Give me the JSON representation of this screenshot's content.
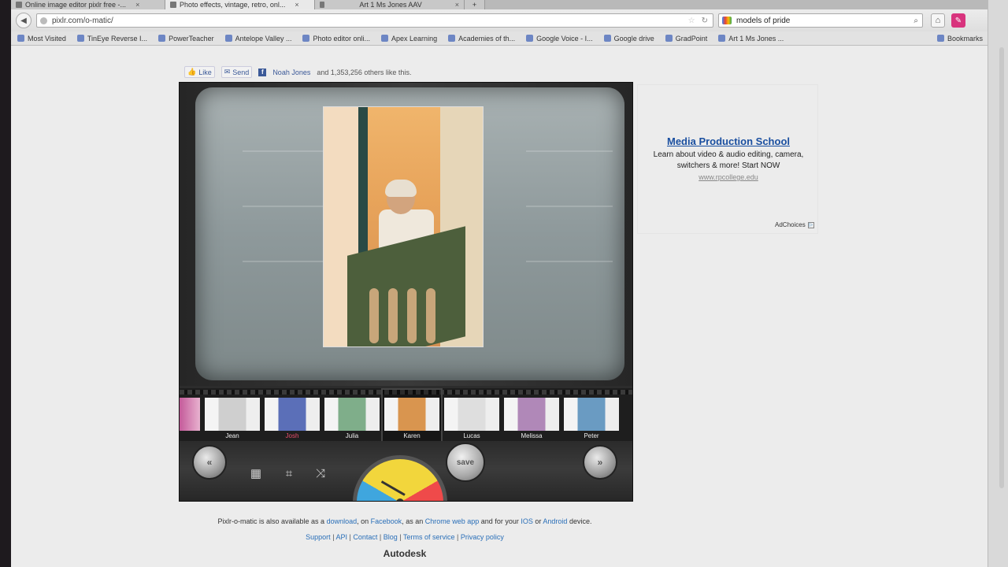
{
  "browser": {
    "tabs": [
      {
        "label": "Online image editor pixlr free -..."
      },
      {
        "label": "Photo effects, vintage, retro, onl..."
      },
      {
        "label": "Art 1 Ms Jones AAV"
      }
    ],
    "url": "pixlr.com/o-matic/",
    "search_query": "models of pride",
    "bookmarks": [
      {
        "label": "Most Visited"
      },
      {
        "label": "TinEye Reverse I..."
      },
      {
        "label": "PowerTeacher"
      },
      {
        "label": "Antelope Valley ..."
      },
      {
        "label": "Photo editor onli..."
      },
      {
        "label": "Apex Learning"
      },
      {
        "label": "Academies of th..."
      },
      {
        "label": "Google Voice - I..."
      },
      {
        "label": "Google drive"
      },
      {
        "label": "GradPoint"
      },
      {
        "label": "Art 1 Ms Jones ..."
      }
    ],
    "bookmarks_menu": "Bookmarks"
  },
  "social": {
    "like": "Like",
    "send": "Send",
    "name": "Noah Jones",
    "others": "and 1,353,256 others like this."
  },
  "app": {
    "filters": [
      {
        "label": "Jean",
        "highlight": false,
        "tint": "#cfcfcf"
      },
      {
        "label": "Josh",
        "highlight": true,
        "tint": "#5b6fb8"
      },
      {
        "label": "Julia",
        "highlight": false,
        "tint": "#7fae8a"
      },
      {
        "label": "Karen",
        "highlight": false,
        "tint": "#d9954f",
        "selected": true
      },
      {
        "label": "Lucas",
        "highlight": false,
        "tint": "#dedede"
      },
      {
        "label": "Melissa",
        "highlight": false,
        "tint": "#b088b8"
      },
      {
        "label": "Peter",
        "highlight": false,
        "tint": "#6a9bc2"
      }
    ],
    "save_label": "save",
    "prev_label": "«",
    "next_label": "»"
  },
  "ad": {
    "title": "Media Production School",
    "body": "Learn about video & audio editing, camera, switchers & more! Start NOW",
    "url": "www.rpcollege.edu",
    "adchoices": "AdChoices"
  },
  "footer": {
    "avail_prefix": "Pixlr-o-matic is also available as a",
    "download": "download",
    "on": ", on",
    "facebook": "Facebook",
    "as_an": ", as an",
    "chrome": "Chrome web app",
    "and_for": "and for your",
    "ios": "IOS",
    "or": "or",
    "android": "Android",
    "device": "device.",
    "links": [
      "Support",
      "API",
      "Contact",
      "Blog",
      "Terms of service",
      "Privacy policy"
    ],
    "brand": "Autodesk"
  }
}
